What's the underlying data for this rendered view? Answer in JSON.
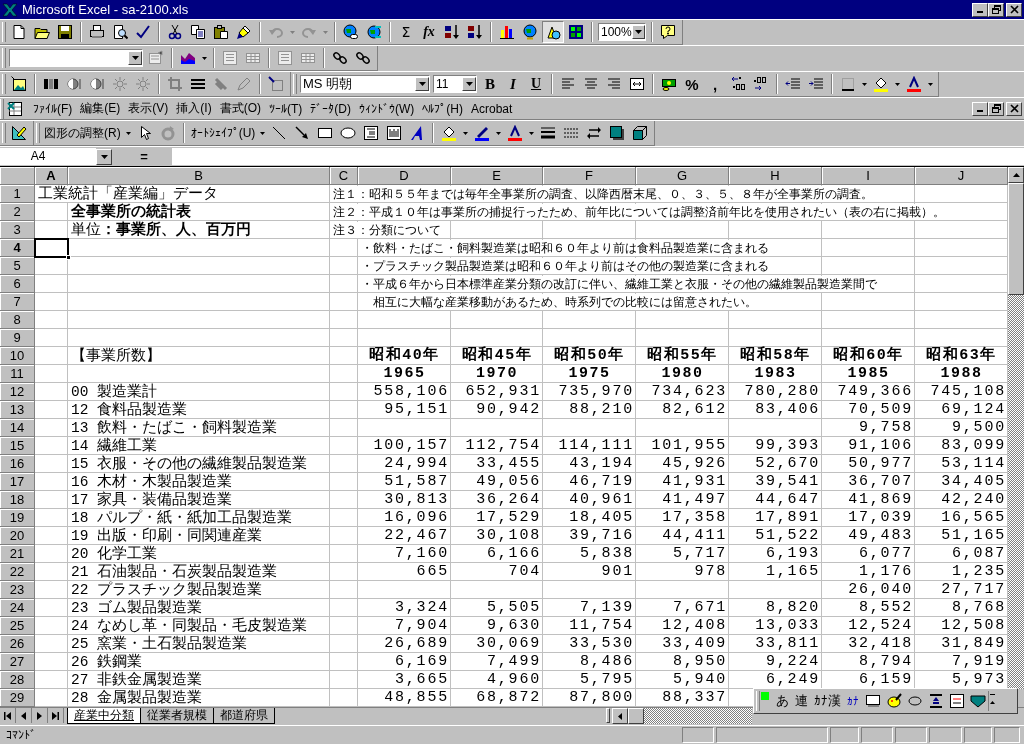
{
  "window": {
    "title": "Microsoft Excel - sa-2100.xls"
  },
  "standard_toolbar": {
    "undo_disabled": true,
    "redo_disabled": true,
    "sum": "Σ",
    "function": "fx",
    "drawing_button_on": true,
    "zoom": "100%"
  },
  "formatting_toolbar": {
    "font": "MS 明朝",
    "size": "11",
    "style_buttons": [
      "B",
      "I",
      "U"
    ],
    "number_buttons": [
      "%",
      ","
    ]
  },
  "menu_bar": {
    "items": [
      "ﾌｧｲﾙ(F)",
      "編集(E)",
      "表示(V)",
      "挿入(I)",
      "書式(O)",
      "ﾂｰﾙ(T)",
      "ﾃﾞｰﾀ(D)",
      "ｳｨﾝﾄﾞｳ(W)",
      "ﾍﾙﾌﾟ(H)",
      "Acrobat"
    ]
  },
  "drawing_toolbar": {
    "draw_menu": "図形の調整(R)",
    "autoshapes_menu": "ｵｰﾄｼｪｲﾌﾟ(U)"
  },
  "formula_bar": {
    "name_box": "A4",
    "equals": "="
  },
  "sheet": {
    "columns": [
      {
        "label": "A",
        "selected": true
      },
      {
        "label": "B",
        "selected": false
      },
      {
        "label": "C",
        "selected": false
      },
      {
        "label": "D",
        "selected": false
      },
      {
        "label": "E",
        "selected": false
      },
      {
        "label": "F",
        "selected": false
      },
      {
        "label": "G",
        "selected": false
      },
      {
        "label": "H",
        "selected": false
      },
      {
        "label": "I",
        "selected": false
      },
      {
        "label": "J",
        "selected": false
      }
    ],
    "rows": [
      {
        "number": "1",
        "selected": false,
        "texts": {
          "A": {
            "kind": "plain",
            "text": "工業統計「産業編」データ"
          },
          "C": {
            "kind": "note",
            "text": "注１：昭和５５年までは毎年全事業所の調査、以降西暦末尾、０、３、５、８年が全事業所の調査。"
          }
        }
      },
      {
        "number": "2",
        "selected": false,
        "texts": {
          "B": {
            "kind": "bold",
            "text": "全事業所の統計表"
          },
          "C": {
            "kind": "note",
            "text": "注２：平成１０年は事業所の捕捉行ったため、前年比については調整済前年比を使用されたい（表の右に掲載）。"
          }
        }
      },
      {
        "number": "3",
        "selected": false,
        "texts": {
          "B": {
            "kind": "plain",
            "text": "単位**：事業所、人、百万円**"
          },
          "C": {
            "kind": "note",
            "text": "注３：分類について"
          }
        }
      },
      {
        "number": "4",
        "selected": true,
        "texts": {
          "D": {
            "kind": "note",
            "text": "・飲料・たばこ・飼料製造業は昭和６０年より前は食料品製造業に含まれる"
          }
        }
      },
      {
        "number": "5",
        "selected": false,
        "texts": {
          "D": {
            "kind": "note",
            "text": "・プラスチック製品製造業は昭和６０年より前はその他の製造業に含まれる"
          }
        }
      },
      {
        "number": "6",
        "selected": false,
        "texts": {
          "D": {
            "kind": "note",
            "text": "・平成６年から日本標準産業分類の改訂に伴い、繊維工業と衣服・その他の繊維製品製造業間で"
          }
        }
      },
      {
        "number": "7",
        "selected": false,
        "texts": {
          "D": {
            "kind": "note",
            "text": "　相互に大幅な産業移動があるため、時系列での比較には留意されたい。"
          }
        }
      },
      {
        "number": "8",
        "selected": false
      },
      {
        "number": "9",
        "selected": false
      },
      {
        "number": "10",
        "selected": false,
        "texts": {
          "B": {
            "kind": "plain",
            "text": "【事業所数】"
          }
        },
        "headings": {
          "D": "昭和40年",
          "E": "昭和45年",
          "F": "昭和50年",
          "G": "昭和55年",
          "H": "昭和58年",
          "I": "昭和60年",
          "J": "昭和63年"
        }
      },
      {
        "number": "11",
        "selected": false,
        "headings": {
          "D": "1965",
          "E": "1970",
          "F": "1975",
          "G": "1980",
          "H": "1983",
          "I": "1985",
          "J": "1988"
        }
      },
      {
        "number": "12",
        "selected": false,
        "texts": {
          "B": {
            "kind": "plain",
            "text": "00 製造業計"
          }
        },
        "numbers": {
          "D": "558,106",
          "E": "652,931",
          "F": "735,970",
          "G": "734,623",
          "H": "780,280",
          "I": "749,366",
          "J": "745,108"
        }
      },
      {
        "number": "13",
        "selected": false,
        "texts": {
          "B": {
            "kind": "plain",
            "text": "12 食料品製造業"
          }
        },
        "numbers": {
          "D": "95,151",
          "E": "90,942",
          "F": "88,210",
          "G": "82,612",
          "H": "83,406",
          "I": "70,509",
          "J": "69,124"
        }
      },
      {
        "number": "14",
        "selected": false,
        "texts": {
          "B": {
            "kind": "plain",
            "text": "13 飲料・たばこ・飼料製造業"
          }
        },
        "numbers": {
          "I": "9,758",
          "J": "9,500"
        }
      },
      {
        "number": "15",
        "selected": false,
        "texts": {
          "B": {
            "kind": "plain",
            "text": "14 繊維工業"
          }
        },
        "numbers": {
          "D": "100,157",
          "E": "112,754",
          "F": "114,111",
          "G": "101,955",
          "H": "99,393",
          "I": "91,106",
          "J": "83,099"
        }
      },
      {
        "number": "16",
        "selected": false,
        "texts": {
          "B": {
            "kind": "plain",
            "text": "15 衣服・その他の繊維製品製造業"
          }
        },
        "numbers": {
          "D": "24,994",
          "E": "33,455",
          "F": "43,194",
          "G": "45,926",
          "H": "52,670",
          "I": "50,977",
          "J": "53,114"
        }
      },
      {
        "number": "17",
        "selected": false,
        "texts": {
          "B": {
            "kind": "plain",
            "text": "16 木材・木製品製造業"
          }
        },
        "numbers": {
          "D": "51,587",
          "E": "49,056",
          "F": "46,719",
          "G": "41,931",
          "H": "39,541",
          "I": "36,707",
          "J": "34,405"
        }
      },
      {
        "number": "18",
        "selected": false,
        "texts": {
          "B": {
            "kind": "plain",
            "text": "17 家具・装備品製造業"
          }
        },
        "numbers": {
          "D": "30,813",
          "E": "36,264",
          "F": "40,961",
          "G": "41,497",
          "H": "44,647",
          "I": "41,869",
          "J": "42,240"
        }
      },
      {
        "number": "19",
        "selected": false,
        "texts": {
          "B": {
            "kind": "plain",
            "text": "18 パルプ・紙・紙加工品製造業"
          }
        },
        "numbers": {
          "D": "16,096",
          "E": "17,529",
          "F": "18,405",
          "G": "17,358",
          "H": "17,891",
          "I": "17,039",
          "J": "16,565"
        }
      },
      {
        "number": "20",
        "selected": false,
        "texts": {
          "B": {
            "kind": "plain",
            "text": "19 出版・印刷・同関連産業"
          }
        },
        "numbers": {
          "D": "22,467",
          "E": "30,108",
          "F": "39,716",
          "G": "44,411",
          "H": "51,522",
          "I": "49,483",
          "J": "51,165"
        }
      },
      {
        "number": "21",
        "selected": false,
        "texts": {
          "B": {
            "kind": "plain",
            "text": "20 化学工業"
          }
        },
        "numbers": {
          "D": "7,160",
          "E": "6,166",
          "F": "5,838",
          "G": "5,717",
          "H": "6,193",
          "I": "6,077",
          "J": "6,087"
        }
      },
      {
        "number": "22",
        "selected": false,
        "texts": {
          "B": {
            "kind": "plain",
            "text": "21 石油製品・石炭製品製造業"
          }
        },
        "numbers": {
          "D": "665",
          "E": "704",
          "F": "901",
          "G": "978",
          "H": "1,165",
          "I": "1,176",
          "J": "1,235"
        }
      },
      {
        "number": "23",
        "selected": false,
        "texts": {
          "B": {
            "kind": "plain",
            "text": "22 プラスチック製品製造業"
          }
        },
        "numbers": {
          "I": "26,040",
          "J": "27,717"
        }
      },
      {
        "number": "24",
        "selected": false,
        "texts": {
          "B": {
            "kind": "plain",
            "text": "23 ゴム製品製造業"
          }
        },
        "numbers": {
          "D": "3,324",
          "E": "5,505",
          "F": "7,139",
          "G": "7,671",
          "H": "8,820",
          "I": "8,552",
          "J": "8,768"
        }
      },
      {
        "number": "25",
        "selected": false,
        "texts": {
          "B": {
            "kind": "plain",
            "text": "24 なめし革・同製品・毛皮製造業"
          }
        },
        "numbers": {
          "D": "7,904",
          "E": "9,630",
          "F": "11,754",
          "G": "12,408",
          "H": "13,033",
          "I": "12,524",
          "J": "12,508"
        }
      },
      {
        "number": "26",
        "selected": false,
        "texts": {
          "B": {
            "kind": "plain",
            "text": "25 窯業・土石製品製造業"
          }
        },
        "numbers": {
          "D": "26,689",
          "E": "30,069",
          "F": "33,530",
          "G": "33,409",
          "H": "33,811",
          "I": "32,418",
          "J": "31,849"
        }
      },
      {
        "number": "27",
        "selected": false,
        "texts": {
          "B": {
            "kind": "plain",
            "text": "26 鉄鋼業"
          }
        },
        "numbers": {
          "D": "6,169",
          "E": "7,499",
          "F": "8,486",
          "G": "8,950",
          "H": "9,224",
          "I": "8,794",
          "J": "7,919"
        }
      },
      {
        "number": "28",
        "selected": false,
        "texts": {
          "B": {
            "kind": "plain",
            "text": "27 非鉄金属製造業"
          }
        },
        "numbers": {
          "D": "3,665",
          "E": "4,960",
          "F": "5,795",
          "G": "5,940",
          "H": "6,249",
          "I": "6,159",
          "J": "5,973"
        }
      },
      {
        "number": "29",
        "selected": false,
        "texts": {
          "B": {
            "kind": "plain",
            "text": "28 金属製品製造業"
          }
        },
        "numbers": {
          "D": "48,855",
          "E": "68,872",
          "F": "87,800",
          "G": "88,337"
        }
      }
    ]
  },
  "sheet_tabs": [
    {
      "label": "産業中分類",
      "selected": true
    },
    {
      "label": "従業者規模",
      "selected": false
    },
    {
      "label": "都道府県",
      "selected": false
    }
  ],
  "ime_toolbar": {
    "buttons": [
      "あ",
      "連",
      "ｶﾅ漢"
    ],
    "kana": "ｶﾅ"
  },
  "status_bar": {
    "text": "ｺﾏﾝﾄﾞ"
  }
}
